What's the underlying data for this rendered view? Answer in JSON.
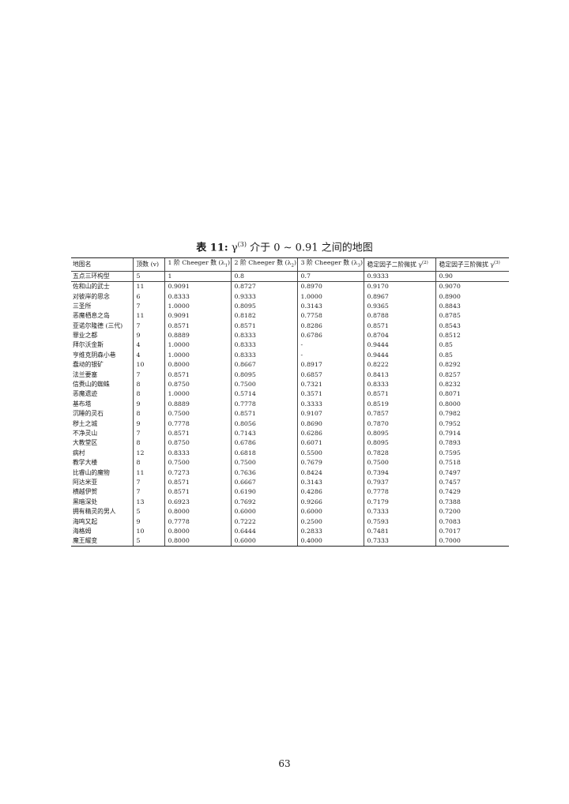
{
  "caption": {
    "label": "表 11:",
    "gamma": "γ",
    "gamma_sup": "(3)",
    "text": "介于 0 ∼ 0.91 之间的地图"
  },
  "table": {
    "headers": [
      {
        "text": "地图名"
      },
      {
        "text": "顶数 (v)"
      },
      {
        "text": "1 阶 Cheeger 数 (λ",
        "sub": "1",
        "tail": ")"
      },
      {
        "text": "2 阶 Cheeger 数 (λ",
        "sub": "2",
        "tail": ")"
      },
      {
        "text": "3 阶 Cheeger 数 (λ",
        "sub": "3",
        "tail": ")"
      },
      {
        "text": "稳定因子二阶微扰 γ",
        "sup": "(2)"
      },
      {
        "text": "稳定因子三阶微扰 γ",
        "sup": "(3)"
      }
    ],
    "rows": [
      [
        "五点三环构型",
        "5",
        "1",
        "0.8",
        "0.7",
        "0.9333",
        "0.90"
      ],
      [
        "佐和山的武士",
        "11",
        "0.9091",
        "0.8727",
        "0.8970",
        "0.9170",
        "0.9070"
      ],
      [
        "对彼岸的思念",
        "6",
        "0.8333",
        "0.9333",
        "1.0000",
        "0.8967",
        "0.8900"
      ],
      [
        "三圣所",
        "7",
        "1.0000",
        "0.8095",
        "0.3143",
        "0.9365",
        "0.8843"
      ],
      [
        "恶魔栖息之岛",
        "11",
        "0.9091",
        "0.8182",
        "0.7758",
        "0.8788",
        "0.8785"
      ],
      [
        "亚诺尔隆德 (三代)",
        "7",
        "0.8571",
        "0.8571",
        "0.8286",
        "0.8571",
        "0.8543"
      ],
      [
        "罪业之都",
        "9",
        "0.8889",
        "0.8333",
        "0.6786",
        "0.8704",
        "0.8512"
      ],
      [
        "拜尔沃金斯",
        "4",
        "1.0000",
        "0.8333",
        "-",
        "0.9444",
        "0.85"
      ],
      [
        "亨维克阴森小巷",
        "4",
        "1.0000",
        "0.8333",
        "-",
        "0.9444",
        "0.85"
      ],
      [
        "蠢动的银矿",
        "10",
        "0.8000",
        "0.8667",
        "0.8917",
        "0.8222",
        "0.8292"
      ],
      [
        "法兰要塞",
        "7",
        "0.8571",
        "0.8095",
        "0.6857",
        "0.8413",
        "0.8257"
      ],
      [
        "信赉山的蜘蛛",
        "8",
        "0.8750",
        "0.7500",
        "0.7321",
        "0.8333",
        "0.8232"
      ],
      [
        "恶魔遗迹",
        "8",
        "1.0000",
        "0.5714",
        "0.3571",
        "0.8571",
        "0.8071"
      ],
      [
        "基布塔",
        "9",
        "0.8889",
        "0.7778",
        "0.3333",
        "0.8519",
        "0.8000"
      ],
      [
        "沉睡的灵石",
        "8",
        "0.7500",
        "0.8571",
        "0.9107",
        "0.7857",
        "0.7982"
      ],
      [
        "秽土之城",
        "9",
        "0.7778",
        "0.8056",
        "0.8690",
        "0.7870",
        "0.7952"
      ],
      [
        "不净灵山",
        "7",
        "0.8571",
        "0.7143",
        "0.6286",
        "0.8095",
        "0.7914"
      ],
      [
        "大教堂区",
        "8",
        "0.8750",
        "0.6786",
        "0.6071",
        "0.8095",
        "0.7893"
      ],
      [
        "病村",
        "12",
        "0.8333",
        "0.6818",
        "0.5500",
        "0.7828",
        "0.7595"
      ],
      [
        "教学大楼",
        "8",
        "0.7500",
        "0.7500",
        "0.7679",
        "0.7500",
        "0.7518"
      ],
      [
        "比睿山的魔物",
        "11",
        "0.7273",
        "0.7636",
        "0.8424",
        "0.7394",
        "0.7497"
      ],
      [
        "阿达米亚",
        "7",
        "0.8571",
        "0.6667",
        "0.3143",
        "0.7937",
        "0.7457"
      ],
      [
        "横越伊贺",
        "7",
        "0.8571",
        "0.6190",
        "0.4286",
        "0.7778",
        "0.7429"
      ],
      [
        "黑暗深处",
        "13",
        "0.6923",
        "0.7692",
        "0.9266",
        "0.7179",
        "0.7388"
      ],
      [
        "拥有精灵的男人",
        "5",
        "0.8000",
        "0.6000",
        "0.6000",
        "0.7333",
        "0.7200"
      ],
      [
        "海鸣又起",
        "9",
        "0.7778",
        "0.7222",
        "0.2500",
        "0.7593",
        "0.7083"
      ],
      [
        "海格姆",
        "10",
        "0.8000",
        "0.6444",
        "0.2833",
        "0.7481",
        "0.7017"
      ],
      [
        "魔王耀变",
        "5",
        "0.8000",
        "0.6000",
        "0.4000",
        "0.7333",
        "0.7000"
      ]
    ]
  },
  "page_number": "63"
}
